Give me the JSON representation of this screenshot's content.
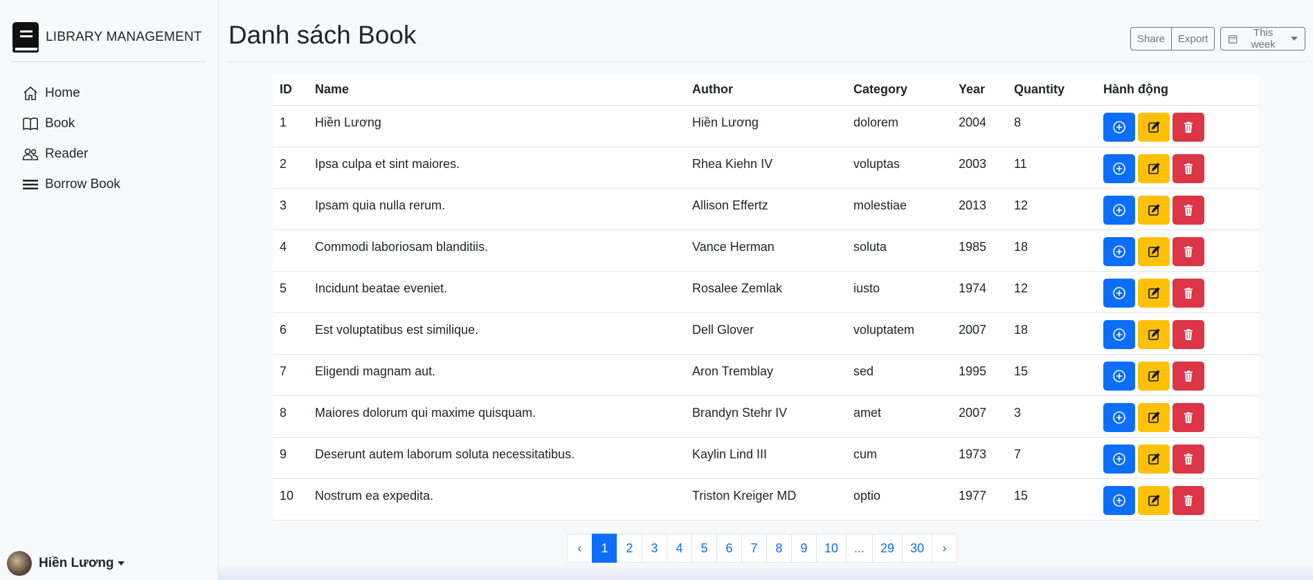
{
  "sidebar": {
    "brand": "LIBRARY MANAGEMENT",
    "items": [
      {
        "label": "Home",
        "icon": "home-icon"
      },
      {
        "label": "Book",
        "icon": "book-icon"
      },
      {
        "label": "Reader",
        "icon": "people-icon"
      },
      {
        "label": "Borrow Book",
        "icon": "list-icon"
      }
    ],
    "user": "Hiền Lương"
  },
  "header": {
    "title": "Danh sách Book",
    "share_label": "Share",
    "export_label": "Export",
    "period_label": "This week"
  },
  "table": {
    "headers": [
      "ID",
      "Name",
      "Author",
      "Category",
      "Year",
      "Quantity",
      "Hành động"
    ],
    "rows": [
      {
        "id": "1",
        "name": "Hiền Lương",
        "author": "Hiền Lương",
        "category": "dolorem",
        "year": "2004",
        "quantity": "8"
      },
      {
        "id": "2",
        "name": "Ipsa culpa et sint maiores.",
        "author": "Rhea Kiehn IV",
        "category": "voluptas",
        "year": "2003",
        "quantity": "11"
      },
      {
        "id": "3",
        "name": "Ipsam quia nulla rerum.",
        "author": "Allison Effertz",
        "category": "molestiae",
        "year": "2013",
        "quantity": "12"
      },
      {
        "id": "4",
        "name": "Commodi laboriosam blanditiis.",
        "author": "Vance Herman",
        "category": "soluta",
        "year": "1985",
        "quantity": "18"
      },
      {
        "id": "5",
        "name": "Incidunt beatae eveniet.",
        "author": "Rosalee Zemlak",
        "category": "iusto",
        "year": "1974",
        "quantity": "12"
      },
      {
        "id": "6",
        "name": "Est voluptatibus est similique.",
        "author": "Dell Glover",
        "category": "voluptatem",
        "year": "2007",
        "quantity": "18"
      },
      {
        "id": "7",
        "name": "Eligendi magnam aut.",
        "author": "Aron Tremblay",
        "category": "sed",
        "year": "1995",
        "quantity": "15"
      },
      {
        "id": "8",
        "name": "Maiores dolorum qui maxime quisquam.",
        "author": "Brandyn Stehr IV",
        "category": "amet",
        "year": "2007",
        "quantity": "3"
      },
      {
        "id": "9",
        "name": "Deserunt autem laborum soluta necessitatibus.",
        "author": "Kaylin Lind III",
        "category": "cum",
        "year": "1973",
        "quantity": "7"
      },
      {
        "id": "10",
        "name": "Nostrum ea expedita.",
        "author": "Triston Kreiger MD",
        "category": "optio",
        "year": "1977",
        "quantity": "15"
      }
    ],
    "actions": {
      "add_icon": "plus-circle-icon",
      "edit_icon": "edit-icon",
      "delete_icon": "trash-icon"
    }
  },
  "pagination": {
    "prev": "‹",
    "pages": [
      "1",
      "2",
      "3",
      "4",
      "5",
      "6",
      "7",
      "8",
      "9",
      "10",
      "...",
      "29",
      "30"
    ],
    "current": "1",
    "next": "›"
  },
  "colors": {
    "primary": "#0d6efd",
    "warning": "#ffc107",
    "danger": "#dc3545",
    "background": "#f8f9fa"
  }
}
